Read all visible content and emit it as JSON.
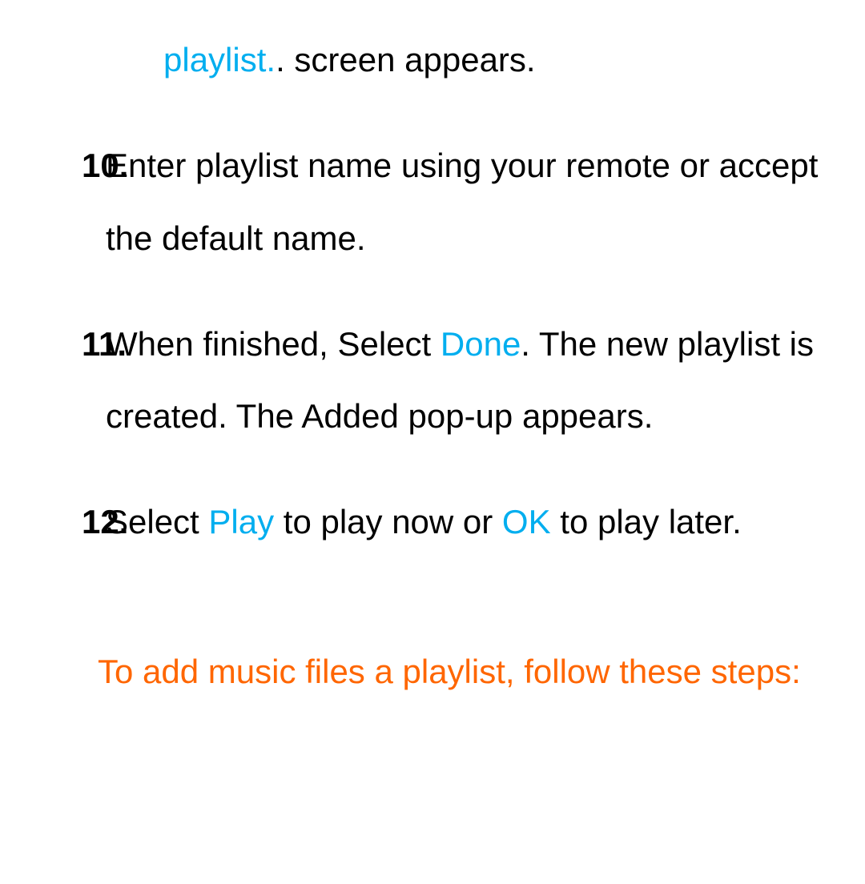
{
  "continuation": {
    "highlight": "playlist.",
    "tail": ". screen appears."
  },
  "steps": [
    {
      "number": "10.",
      "text": "Enter playlist name using your remote or accept the default name."
    },
    {
      "number": "11.",
      "before": "When finished, Select ",
      "highlight": "Done",
      "after": ". The new playlist is created. The Added pop-up appears."
    },
    {
      "number": "12.",
      "p1": " Select ",
      "h1": "Play",
      "p2": " to play now or ",
      "h2": "OK",
      "p3": " to play later."
    }
  ],
  "heading": "To add music files a playlist, follow these steps:"
}
